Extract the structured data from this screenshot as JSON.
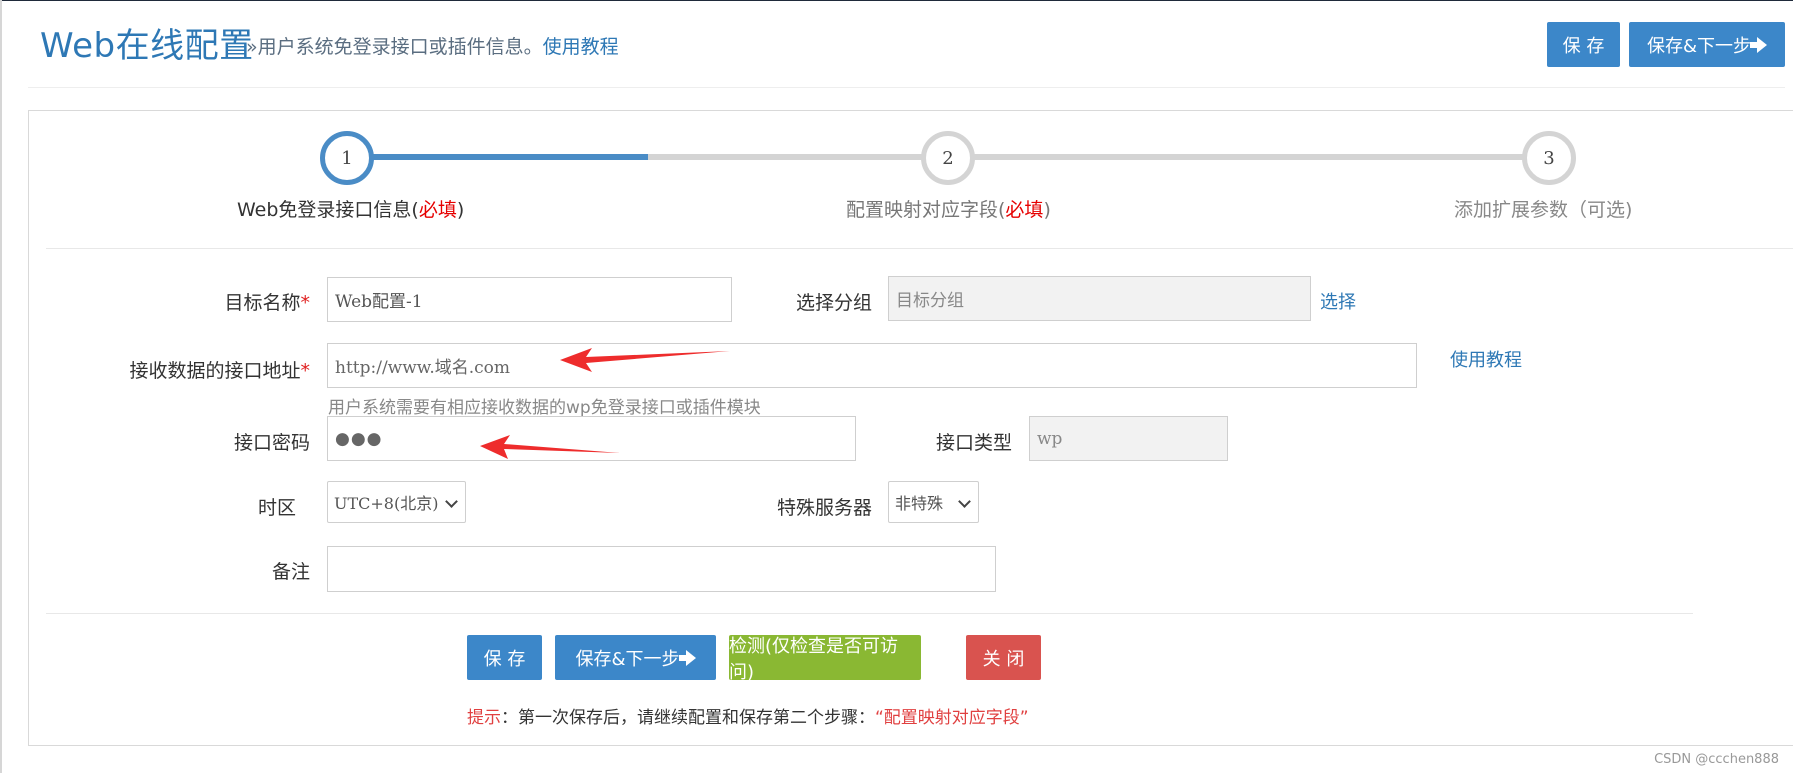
{
  "header": {
    "title": "Web在线配置",
    "subtitle": "»用户系统免登录接口或插件信息。",
    "subtitle_link": "使用教程",
    "save_label": "保 存",
    "save_next_label": "保存&下一步"
  },
  "stepper": {
    "steps": [
      {
        "number": "1",
        "label": "Web免登录接口信息(",
        "required": "必填",
        "suffix": ")"
      },
      {
        "number": "2",
        "label": "配置映射对应字段(",
        "required": "必填",
        "suffix": ")"
      },
      {
        "number": "3",
        "label": "添加扩展参数（可选)"
      }
    ],
    "active_color": "#4a8cc6",
    "inactive_color": "#d4d4d4"
  },
  "form": {
    "target_name": {
      "label": "目标名称",
      "required_mark": "*",
      "value": "Web配置-1"
    },
    "group": {
      "label": "选择分组",
      "placeholder": "目标分组",
      "select_link": "选择"
    },
    "endpoint": {
      "label": "接收数据的接口地址",
      "required_mark": "*",
      "placeholder": "http://www.域名.com",
      "help": "用户系统需要有相应接收数据的wp免登录接口或插件模块",
      "tutorial_link": "使用教程"
    },
    "password": {
      "label": "接口密码",
      "value": "●●●"
    },
    "interface_type": {
      "label": "接口类型",
      "value": "wp"
    },
    "timezone": {
      "label": "时区",
      "value": "UTC+8(北京)"
    },
    "special_server": {
      "label": "特殊服务器",
      "value": "非特殊"
    },
    "note": {
      "label": "备注",
      "value": ""
    }
  },
  "actions": {
    "save": "保 存",
    "save_next": "保存&下一步",
    "check": "检测(仅检查是否可访问)",
    "close": "关 闭"
  },
  "tip": {
    "prefix": "提示",
    "text": "：第一次保存后，请继续配置和保存第二个步骤：",
    "highlight": "“配置映射对应字段”"
  },
  "watermark": "CSDN @ccchen888",
  "colors": {
    "primary": "#3c87c9",
    "success": "#8ab833",
    "danger": "#d9534f",
    "required": "#e60000",
    "annotation_arrow": "#ee2c2c"
  }
}
